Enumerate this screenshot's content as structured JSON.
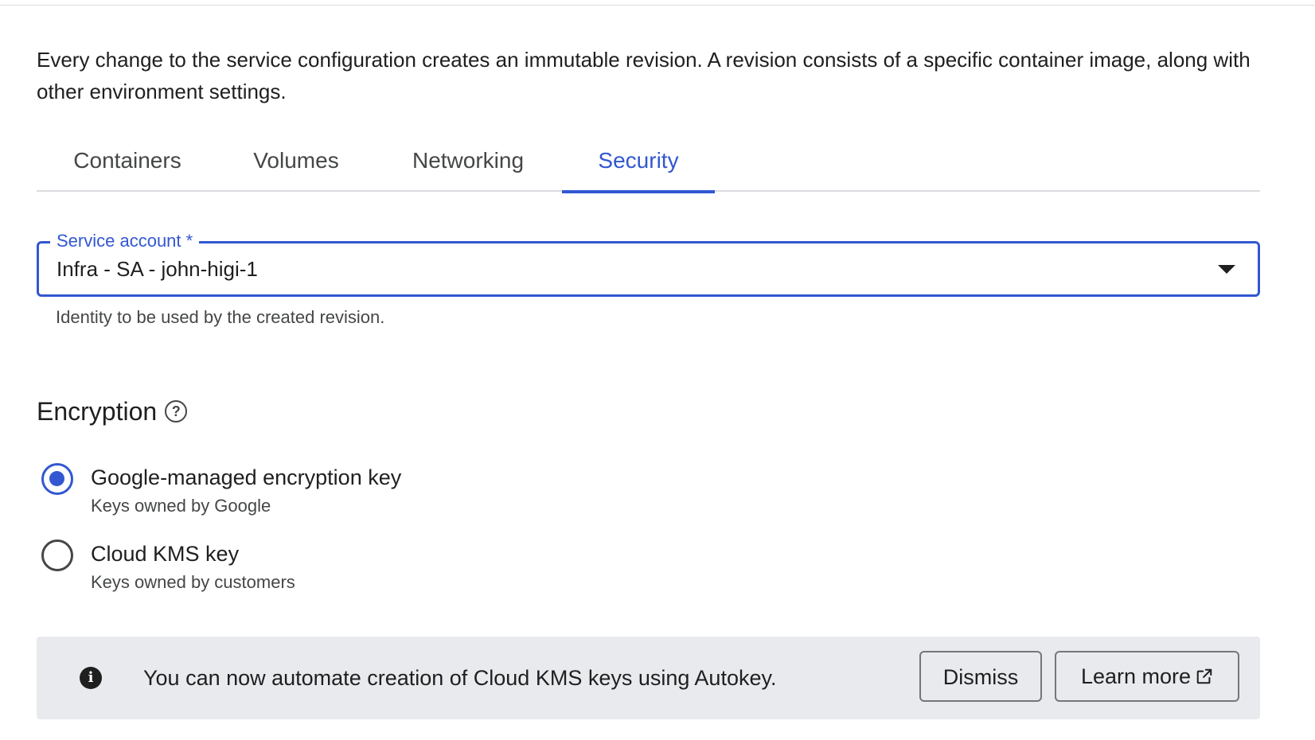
{
  "intro": {
    "text": "Every change to the service configuration creates an immutable revision. A revision consists of a specific container image, along with other environment settings."
  },
  "tabs": [
    {
      "label": "Containers"
    },
    {
      "label": "Volumes"
    },
    {
      "label": "Networking"
    },
    {
      "label": "Security"
    }
  ],
  "active_tab": "Security",
  "service_account": {
    "label": "Service account *",
    "value": "Infra - SA - john-higi-1",
    "hint": "Identity to be used by the created revision."
  },
  "encryption": {
    "title": "Encryption",
    "options": [
      {
        "label": "Google-managed encryption key",
        "sub": "Keys owned by Google",
        "selected": true
      },
      {
        "label": "Cloud KMS key",
        "sub": "Keys owned by customers",
        "selected": false
      }
    ]
  },
  "banner": {
    "text": "You can now automate creation of Cloud KMS keys using Autokey.",
    "dismiss_label": "Dismiss",
    "learn_more_label": "Learn more"
  },
  "colors": {
    "accent": "#3257d1",
    "banner_bg": "#e9eaee",
    "divider": "#dadce0"
  },
  "icons": [
    "help-icon",
    "dropdown-caret-icon",
    "info-icon",
    "external-link-icon"
  ]
}
